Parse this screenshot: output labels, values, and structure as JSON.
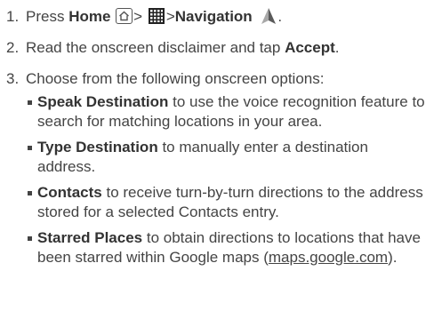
{
  "steps": [
    {
      "number": "1.",
      "parts": {
        "press": "Press",
        "home": "Home",
        "sep1": ">",
        "sep2": ">",
        "navigation": "Navigation",
        "end": "."
      },
      "icons": [
        "home-key-icon",
        "apps-grid-icon",
        "navigation-arrow-icon"
      ]
    },
    {
      "number": "2.",
      "parts": {
        "pre": "Read the onscreen disclaimer and tap",
        "accept": "Accept",
        "end": "."
      }
    },
    {
      "number": "3.",
      "text": "Choose from the following onscreen options:",
      "options": [
        {
          "label": "Speak Destination",
          "text": "to use the voice recognition feature to search for matching locations in your area."
        },
        {
          "label": "Type Destination",
          "text": "to manually enter a destination address."
        },
        {
          "label": "Contacts",
          "text": "to receive turn-by-turn directions to the address stored for a selected Contacts entry."
        },
        {
          "label": "Starred Places",
          "text": "to obtain directions to locations that have been starred within Google maps",
          "link_open": "(",
          "link": "maps.google.com",
          "link_close": ")."
        }
      ]
    }
  ],
  "colors": {
    "text": "#444444",
    "bold": "#333333",
    "background": "#ffffff"
  }
}
